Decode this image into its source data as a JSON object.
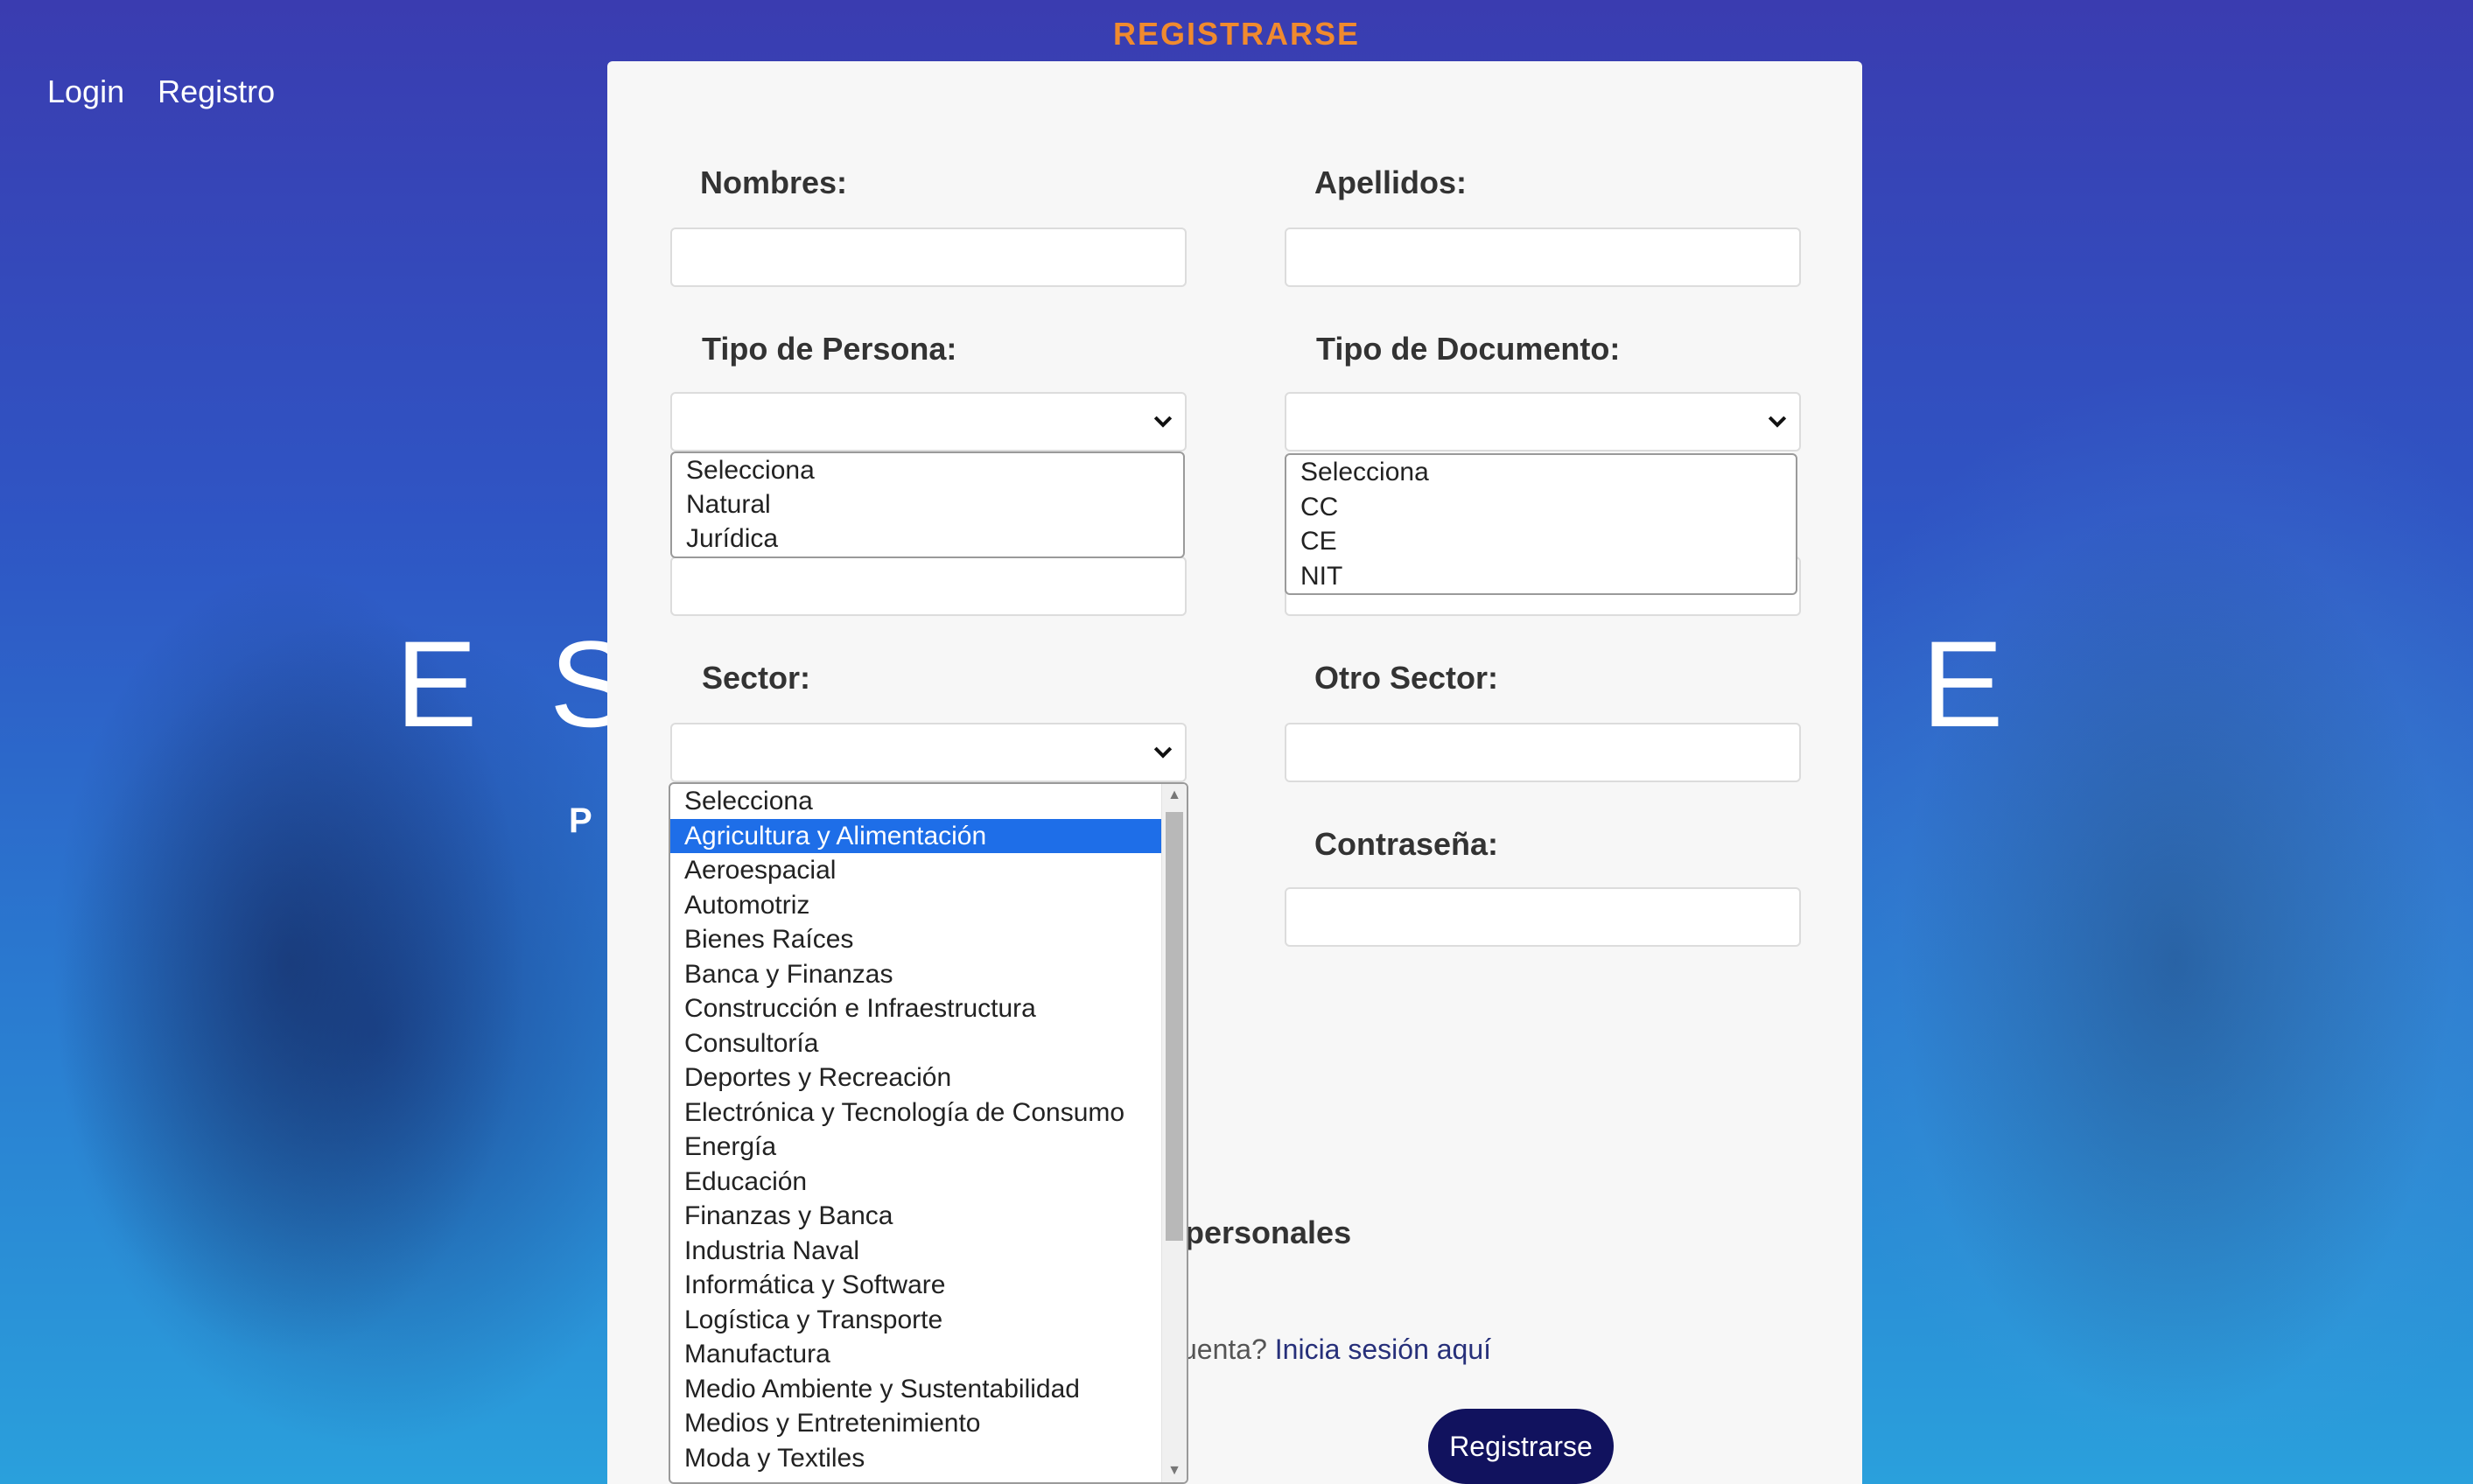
{
  "nav": {
    "login": "Login",
    "registro": "Registro"
  },
  "hero": {
    "letter_1": "E",
    "letter_2": "S",
    "letter_3": "E",
    "subtitle_fragment": "P"
  },
  "page_title": "REGISTRARSE",
  "form": {
    "nombres_label": "Nombres:",
    "apellidos_label": "Apellidos:",
    "tipo_persona_label": "Tipo de Persona:",
    "tipo_documento_label": "Tipo de Documento:",
    "sector_label": "Sector:",
    "otro_sector_label": "Otro Sector:",
    "contrasena_label": "Contraseña:",
    "tipo_persona_options": [
      "Selecciona",
      "Natural",
      "Jurídica"
    ],
    "tipo_documento_options": [
      "Selecciona",
      "CC",
      "CE",
      "NIT"
    ],
    "sector_options": [
      "Selecciona",
      "Agricultura y Alimentación",
      "Aeroespacial",
      "Automotriz",
      "Bienes Raíces",
      "Banca y Finanzas",
      "Construcción e Infraestructura",
      "Consultoría",
      "Deportes y Recreación",
      "Electrónica y Tecnología de Consumo",
      "Energía",
      "Educación",
      "Finanzas y Banca",
      "Industria Naval",
      "Informática y Software",
      "Logística y Transporte",
      "Manufactura",
      "Medio Ambiente y Sustentabilidad",
      "Medios y Entretenimiento",
      "Moda y Textiles"
    ],
    "sector_highlighted": "Agricultura y Alimentación",
    "terms_fragment": "personales",
    "login_prompt_fragment": "uenta?",
    "login_link": "Inicia sesión aquí",
    "submit_label": "Registrarse"
  },
  "colors": {
    "title_orange": "#f08a2e",
    "button_navy": "#11125e",
    "highlight_blue": "#1e6ee8",
    "link_navy": "#27307a"
  }
}
